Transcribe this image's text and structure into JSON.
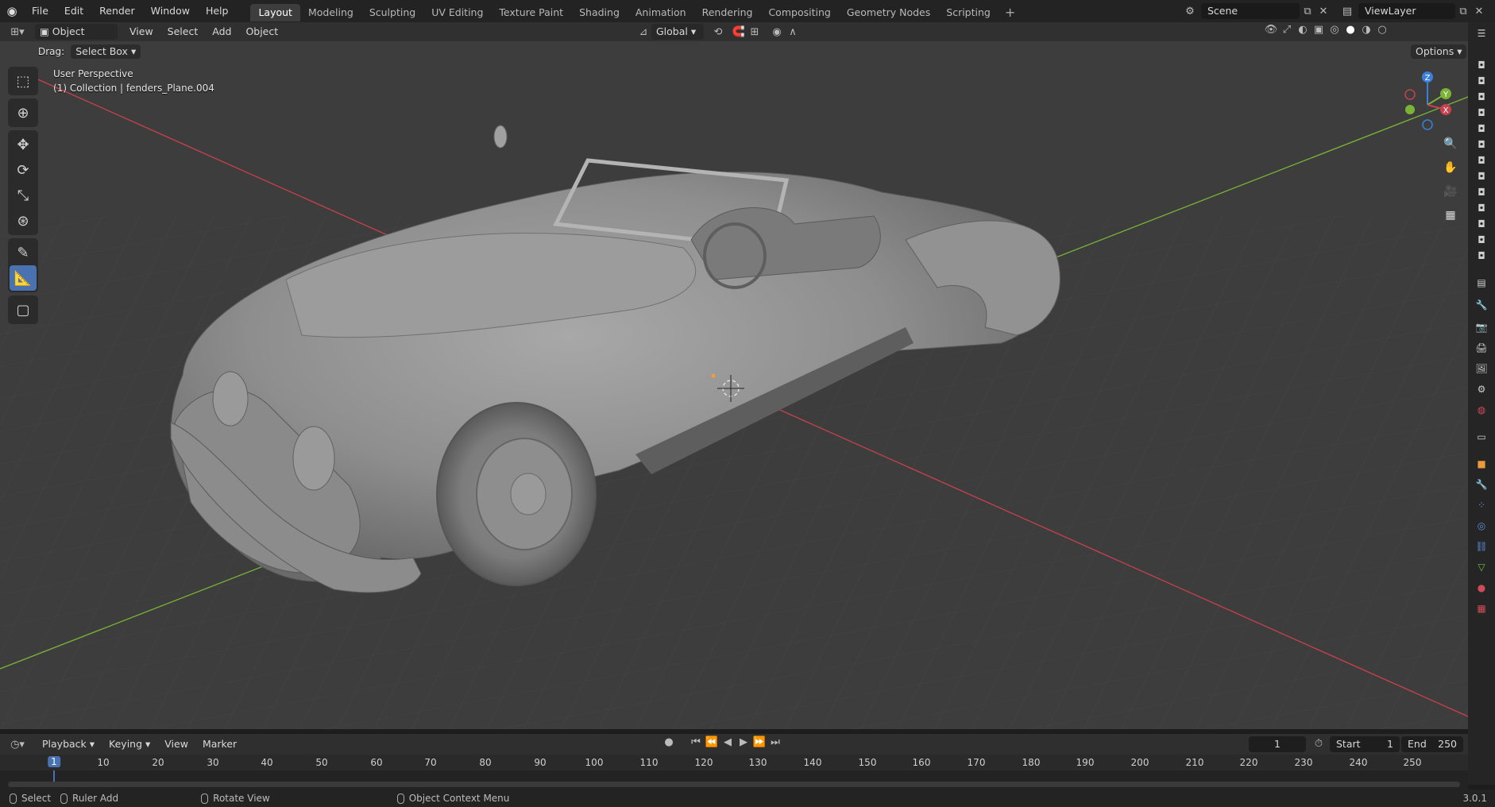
{
  "topbar": {
    "menus": [
      "File",
      "Edit",
      "Render",
      "Window",
      "Help"
    ],
    "workspaces": [
      "Layout",
      "Modeling",
      "Sculpting",
      "UV Editing",
      "Texture Paint",
      "Shading",
      "Animation",
      "Rendering",
      "Compositing",
      "Geometry Nodes",
      "Scripting"
    ],
    "active_workspace": "Layout",
    "scene": "Scene",
    "view_layer": "ViewLayer"
  },
  "header": {
    "mode": "Object Mode",
    "menus": [
      "View",
      "Select",
      "Add",
      "Object"
    ],
    "orientation": "Global",
    "drag_label": "Drag:",
    "drag_value": "Select Box",
    "options": "Options"
  },
  "viewport": {
    "perspective": "User Perspective",
    "collection": "(1) Collection | fenders_Plane.004",
    "gizmo": {
      "x": "X",
      "y": "Y",
      "z": "Z"
    }
  },
  "timeline": {
    "menus": [
      "Playback",
      "Keying",
      "View",
      "Marker"
    ],
    "current_frame": "1",
    "start_label": "Start",
    "start": "1",
    "end_label": "End",
    "end": "250",
    "ruler": [
      "1",
      "10",
      "20",
      "30",
      "40",
      "50",
      "60",
      "70",
      "80",
      "90",
      "100",
      "110",
      "120",
      "130",
      "140",
      "150",
      "160",
      "170",
      "180",
      "190",
      "200",
      "210",
      "220",
      "230",
      "240",
      "250"
    ]
  },
  "status": {
    "select": "Select",
    "ruler_add": "Ruler Add",
    "rotate_view": "Rotate View",
    "context_menu": "Object Context Menu",
    "version": "3.0.1"
  },
  "colors": {
    "accent": "#4a72b0",
    "x_axis": "#c8414e",
    "y_axis": "#7ab335",
    "z_axis": "#3b7fd9"
  }
}
